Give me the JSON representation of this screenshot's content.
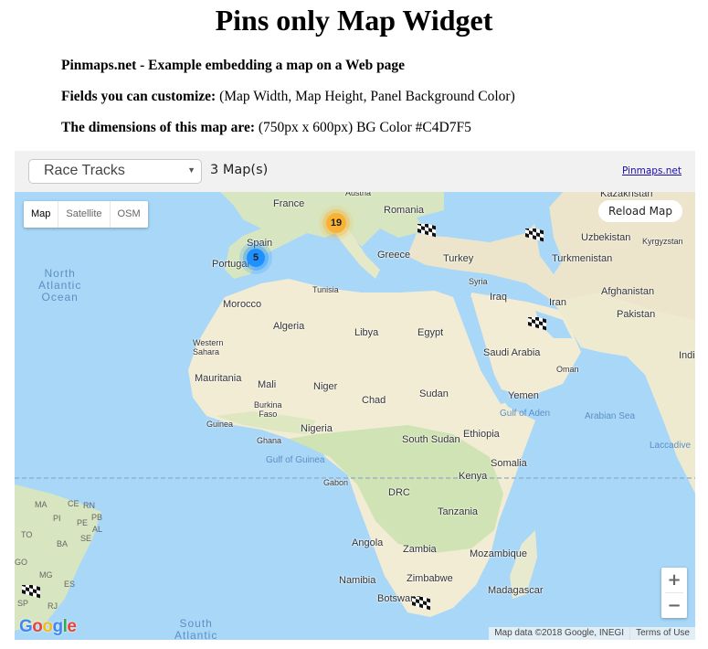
{
  "page": {
    "title": "Pins only Map Widget",
    "line1_bold": "Pinmaps.net - Example embedding a map on a Web page",
    "line2_bold": "Fields you can customize:",
    "line2_text": " (Map Width, Map Height, Panel Background Color)",
    "line3_bold": "The dimensions of this map are:",
    "line3_text": " (750px x 600px) BG Color #C4D7F5"
  },
  "panel": {
    "select_value": "Race Tracks",
    "map_count": "3 Map(s)",
    "brand_link": "Pinmaps.net"
  },
  "map": {
    "map_types": [
      {
        "label": "Map",
        "active": true
      },
      {
        "label": "Satellite",
        "active": false
      },
      {
        "label": "OSM",
        "active": false
      }
    ],
    "reload_label": "Reload Map",
    "clusters": [
      {
        "count": "5",
        "color": "#1e90ff"
      },
      {
        "count": "19",
        "color": "#f9b233"
      }
    ],
    "flag_icon": "checkered-flag-icon",
    "zoom_in": "+",
    "zoom_out": "−",
    "attribution": "Map data ©2018 Google, INEGI",
    "terms": "Terms of Use",
    "labels": {
      "france": "France",
      "austria": "Austria",
      "romania": "Romania",
      "kazakhstan": "Kazakhstan",
      "spain": "Spain",
      "portugal": "Portugal",
      "greece": "Greece",
      "turkey": "Turkey",
      "uzbekistan": "Uzbekistan",
      "kyrgyzstan": "Kyrgyzstan",
      "turkmenistan": "Turkmenistan",
      "tunisia": "Tunisia",
      "syria": "Syria",
      "iraq": "Iraq",
      "iran": "Iran",
      "afghanistan": "Afghanistan",
      "pakistan": "Pakistan",
      "morocco": "Morocco",
      "algeria": "Algeria",
      "libya": "Libya",
      "egypt": "Egypt",
      "saudi_arabia": "Saudi Arabia",
      "india": "Indi",
      "western_sahara": "Western\nSahara",
      "oman": "Oman",
      "mauritania": "Mauritania",
      "mali": "Mali",
      "niger": "Niger",
      "chad": "Chad",
      "sudan": "Sudan",
      "yemen": "Yemen",
      "gulf_of_aden": "Gulf of Aden",
      "arabian_sea": "Arabian Sea",
      "guinea": "Guinea",
      "burkina_faso": "Burkina\nFaso",
      "nigeria": "Nigeria",
      "ethiopia": "Ethiopia",
      "ghana": "Ghana",
      "south_sudan": "South Sudan",
      "laccadive": "Laccadive",
      "gulf_of_guinea": "Gulf of Guinea",
      "somalia": "Somalia",
      "gabon": "Gabon",
      "kenya": "Kenya",
      "drc": "DRC",
      "tanzania": "Tanzania",
      "angola": "Angola",
      "zambia": "Zambia",
      "mozambique": "Mozambique",
      "namibia": "Namibia",
      "zimbabwe": "Zimbabwe",
      "madagascar": "Madagascar",
      "botswana": "Botswana",
      "north_atlantic": "North\nAtlantic\nOcean",
      "south_atlantic": "South\nAtlantic",
      "ma": "MA",
      "ce": "CE",
      "rn": "RN",
      "pi": "PI",
      "pb": "PB",
      "pe": "PE",
      "al": "AL",
      "to": "TO",
      "ba": "BA",
      "se": "SE",
      "go": "GO",
      "mg": "MG",
      "es": "ES",
      "sp": "SP",
      "rj": "RJ"
    }
  }
}
